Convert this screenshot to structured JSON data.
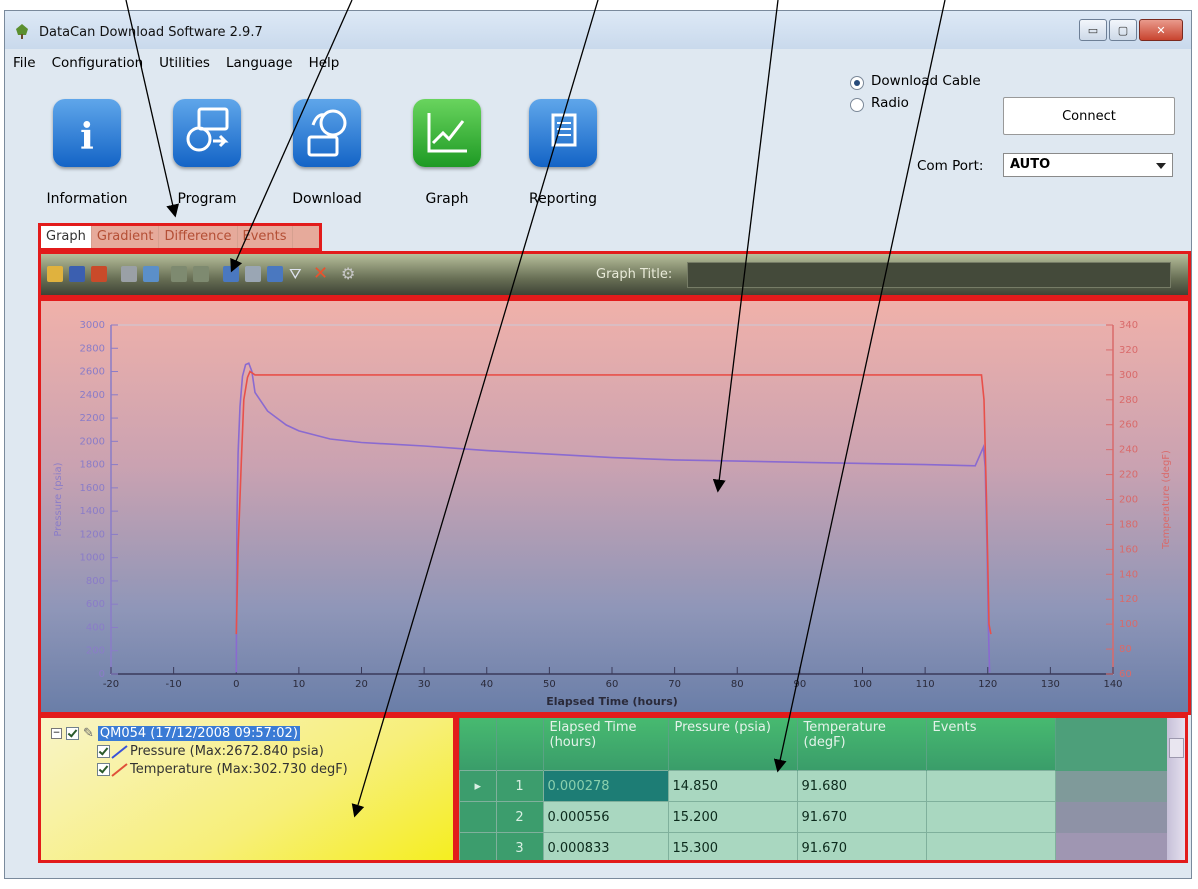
{
  "window": {
    "title": "DataCan Download Software 2.9.7",
    "minimize": "▭",
    "maximize": "▢",
    "close": "✕"
  },
  "menu": [
    "File",
    "Configuration",
    "Utilities",
    "Language",
    "Help"
  ],
  "toolbar_buttons": [
    {
      "label": "Information",
      "icon": "info-icon",
      "color": "blue"
    },
    {
      "label": "Program",
      "icon": "program-icon",
      "color": "blue"
    },
    {
      "label": "Download",
      "icon": "download-icon",
      "color": "blue"
    },
    {
      "label": "Graph",
      "icon": "graph-icon",
      "color": "green"
    },
    {
      "label": "Reporting",
      "icon": "reporting-icon",
      "color": "blue"
    }
  ],
  "connection": {
    "options": [
      "Download Cable",
      "Radio"
    ],
    "selected": "Download Cable",
    "connect_label": "Connect",
    "com_port_label": "Com Port:",
    "com_port_value": "AUTO"
  },
  "tabs": [
    "Graph",
    "Gradient",
    "Difference",
    "Events"
  ],
  "active_tab": "Graph",
  "graph_toolbar": {
    "title_label": "Graph Title:",
    "title_value": "",
    "icons": [
      "open-icon",
      "save-icon",
      "close-file-icon",
      "print-icon",
      "zoom-fit-icon",
      "undo-icon",
      "redo-icon",
      "export-icon",
      "delete-data-icon",
      "import-icon",
      "filter-icon",
      "clear-icon",
      "settings-icon"
    ]
  },
  "chart_data": {
    "type": "line",
    "xlabel": "Elapsed Time (hours)",
    "ylabel": "Pressure (psia)",
    "y2label": "Temperature (degF)",
    "xlim": [
      -20,
      140
    ],
    "ylim": [
      0,
      3000
    ],
    "y2lim": [
      60,
      340
    ],
    "xticks": [
      -20,
      -10,
      0,
      10,
      20,
      30,
      40,
      50,
      60,
      70,
      80,
      90,
      100,
      110,
      120,
      130,
      140
    ],
    "yticks": [
      0,
      200,
      400,
      600,
      800,
      1000,
      1200,
      1400,
      1600,
      1800,
      2000,
      2200,
      2400,
      2600,
      2800,
      3000
    ],
    "y2ticks": [
      60,
      80,
      100,
      120,
      140,
      160,
      180,
      200,
      220,
      240,
      260,
      280,
      300,
      320,
      340
    ],
    "series": [
      {
        "name": "Pressure",
        "axis": "left",
        "color": "#8a6ad0",
        "x": [
          0,
          0.1,
          0.3,
          0.6,
          1,
          1.5,
          2,
          2.5,
          3,
          5,
          8,
          10,
          15,
          20,
          30,
          40,
          50,
          60,
          70,
          80,
          90,
          100,
          110,
          118,
          119.3,
          119.6,
          119.9,
          120.1,
          120.3
        ],
        "y": [
          15,
          1300,
          1900,
          2300,
          2560,
          2660,
          2672,
          2600,
          2420,
          2260,
          2140,
          2090,
          2020,
          1990,
          1960,
          1920,
          1890,
          1860,
          1840,
          1830,
          1820,
          1810,
          1800,
          1790,
          1950,
          1780,
          1050,
          400,
          15
        ]
      },
      {
        "name": "Temperature",
        "axis": "right",
        "color": "#e8504a",
        "x": [
          0,
          0.3,
          0.8,
          1.2,
          1.8,
          2.2,
          3,
          10,
          30,
          60,
          90,
          110,
          119,
          119.4,
          119.8,
          120.2,
          120.5
        ],
        "y": [
          92,
          160,
          230,
          280,
          298,
          302.7,
          300,
          300,
          300,
          300,
          300,
          300,
          300,
          280,
          200,
          100,
          92
        ]
      }
    ]
  },
  "tree": {
    "root_label": "QM054 (17/12/2008 09:57:02)",
    "children": [
      {
        "label": "Pressure (Max:2672.840 psia)",
        "color": "#3a52d8"
      },
      {
        "label": "Temperature (Max:302.730 degF)",
        "color": "#e0503a"
      }
    ]
  },
  "data_table": {
    "columns": [
      "",
      "",
      "Elapsed Time (hours)",
      "Pressure (psia)",
      "Temperature (degF)",
      "Events"
    ],
    "rows": [
      {
        "n": "1",
        "elapsed": "0.000278",
        "pressure": "14.850",
        "temperature": "91.680",
        "events": ""
      },
      {
        "n": "2",
        "elapsed": "0.000556",
        "pressure": "15.200",
        "temperature": "91.670",
        "events": ""
      },
      {
        "n": "3",
        "elapsed": "0.000833",
        "pressure": "15.300",
        "temperature": "91.670",
        "events": ""
      }
    ]
  }
}
